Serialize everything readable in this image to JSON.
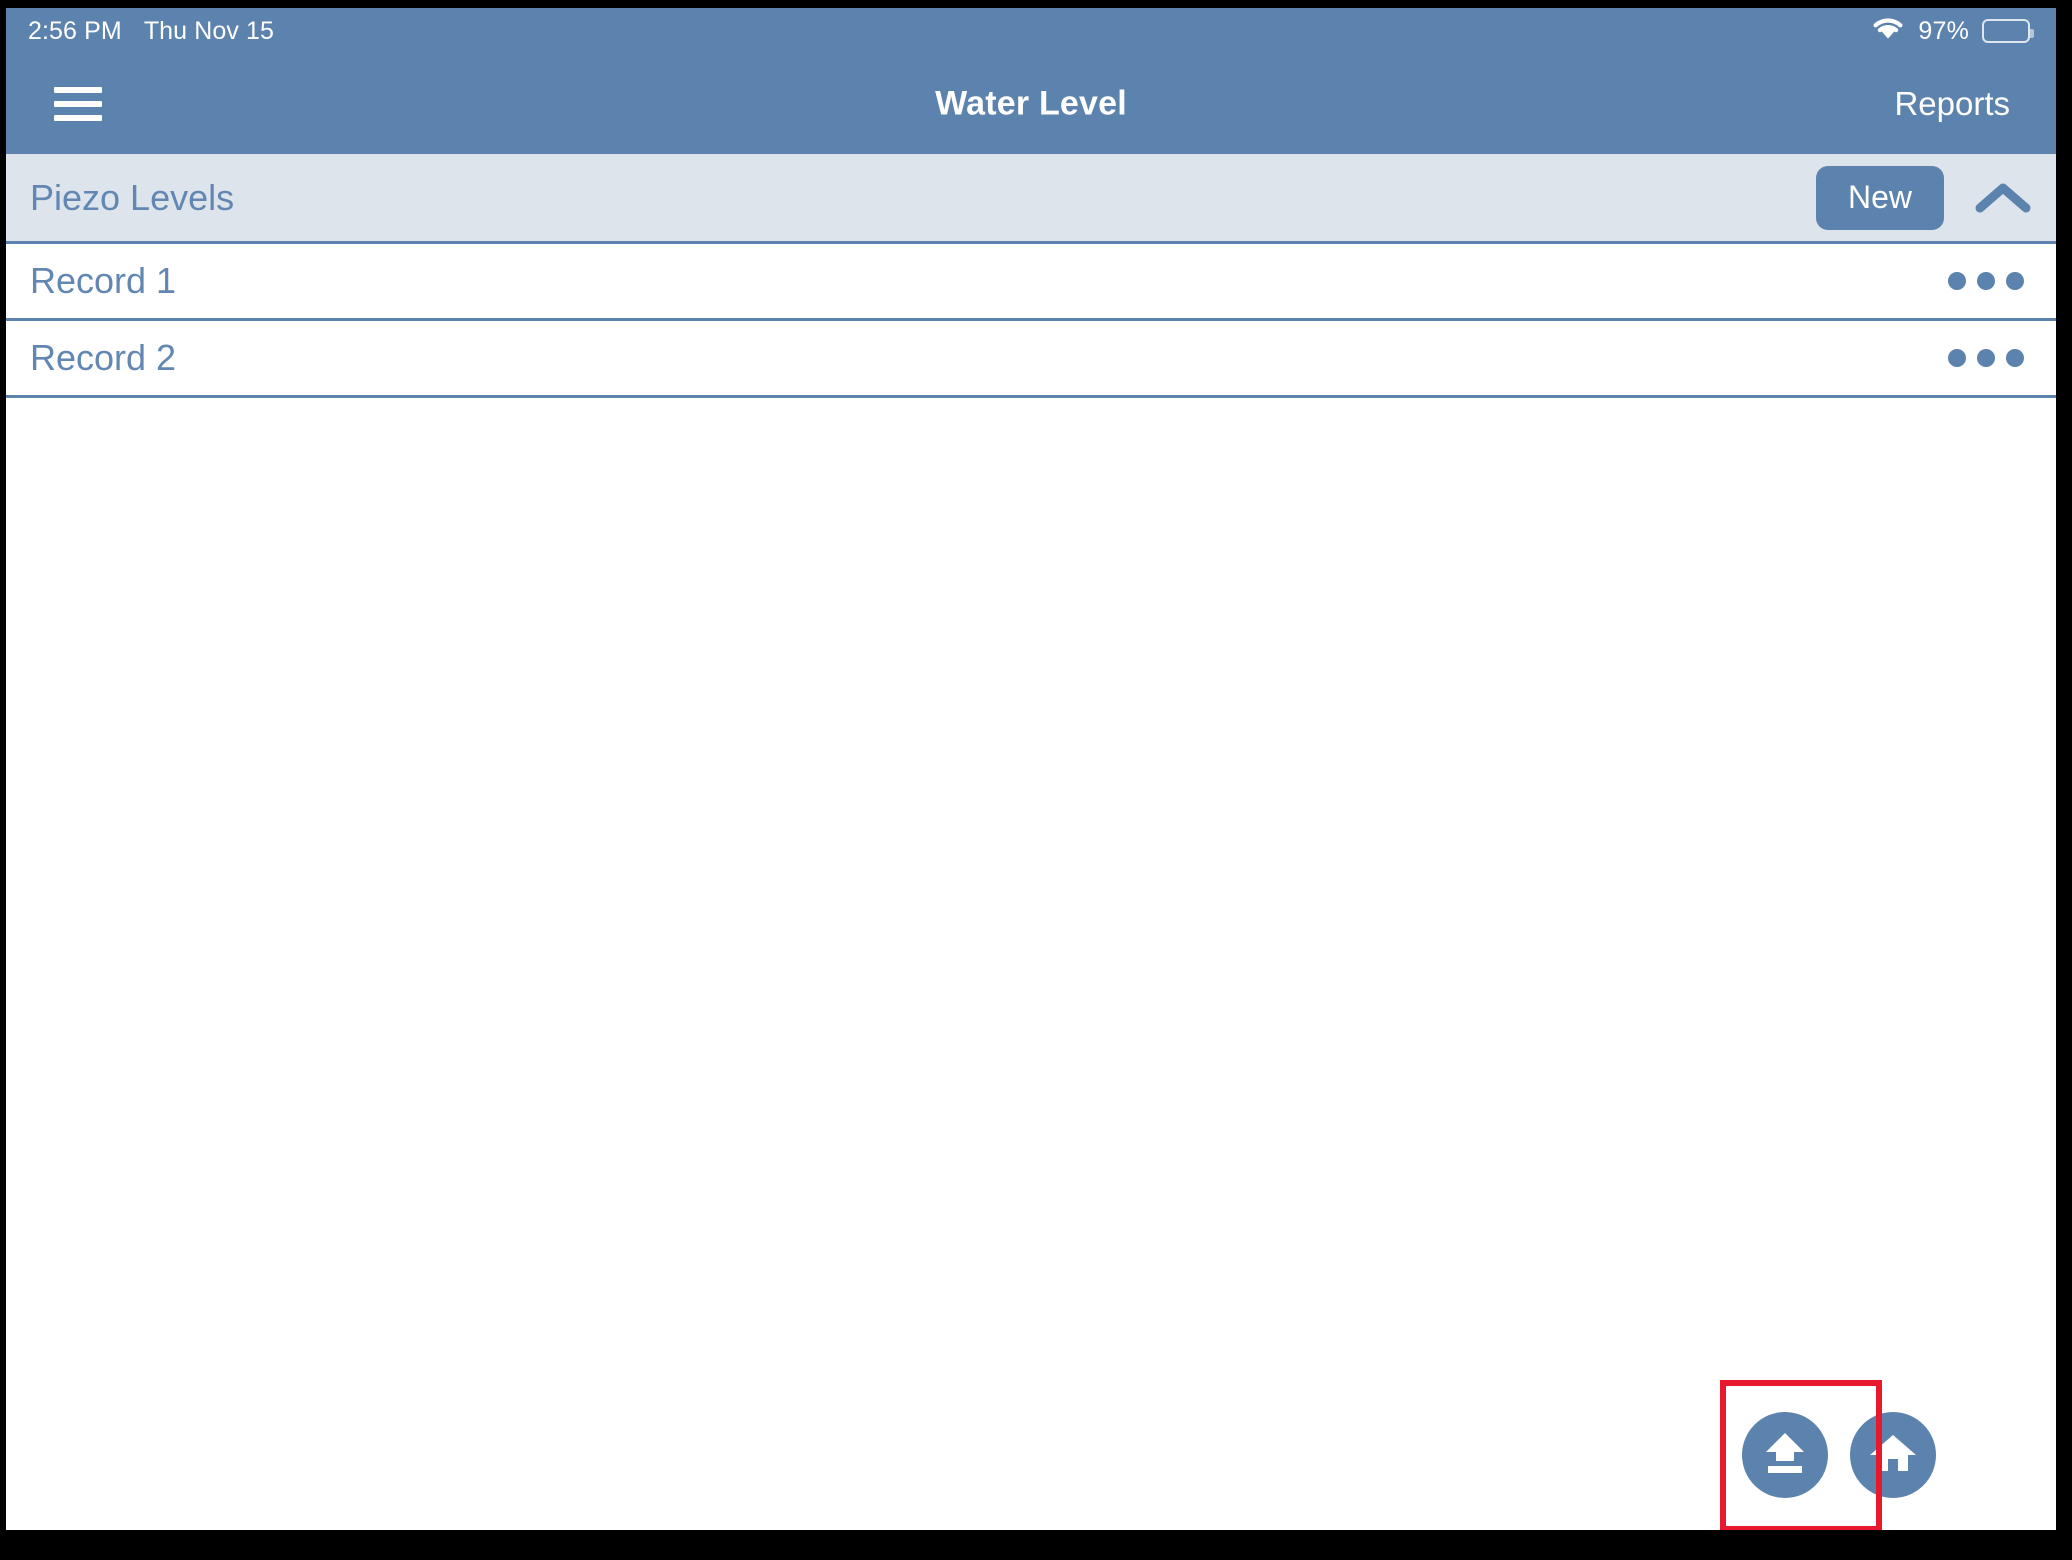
{
  "status_bar": {
    "time": "2:56 PM",
    "date": "Thu Nov 15",
    "wifi_icon": "wifi-icon",
    "battery_percent": "97%",
    "battery_icon": "battery-icon",
    "battery_level": 97
  },
  "nav_bar": {
    "menu_icon": "hamburger-menu-icon",
    "title": "Water Level",
    "action_label": "Reports"
  },
  "section": {
    "title": "Piezo Levels",
    "new_label": "New",
    "collapse_icon": "chevron-up-icon"
  },
  "records": [
    {
      "label": "Record 1",
      "menu_icon": "overflow-menu-icon"
    },
    {
      "label": "Record 2",
      "menu_icon": "overflow-menu-icon"
    }
  ],
  "floating_actions": [
    {
      "name": "upload-button",
      "icon": "upload-icon",
      "highlighted": true
    },
    {
      "name": "home-button",
      "icon": "home-icon",
      "highlighted": false
    }
  ],
  "colors": {
    "accent_blue": "#5c82ae",
    "section_bg": "#dee4ec",
    "text_blue": "#6287b2",
    "highlight_red": "#e8192c",
    "white": "#ffffff",
    "frame_black": "#000000"
  }
}
